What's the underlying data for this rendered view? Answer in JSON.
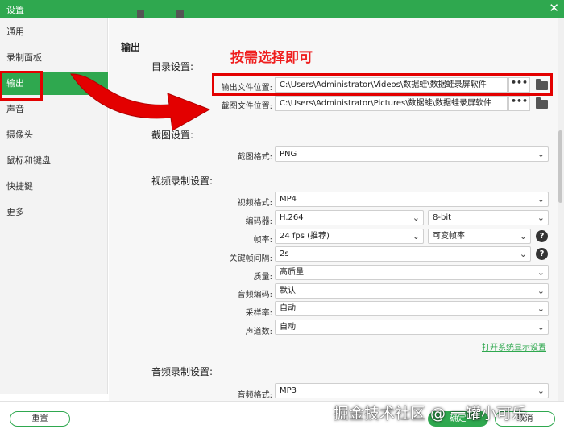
{
  "window": {
    "title": "设置",
    "close_glyph": "✕"
  },
  "sidebar": {
    "items": [
      {
        "label": "通用"
      },
      {
        "label": "录制面板"
      },
      {
        "label": "输出"
      },
      {
        "label": "声音"
      },
      {
        "label": "摄像头"
      },
      {
        "label": "鼠标和键盘"
      },
      {
        "label": "快捷键"
      },
      {
        "label": "更多"
      }
    ],
    "active_index": 2
  },
  "output": {
    "heading": "输出",
    "directory": {
      "heading": "目录设置:",
      "output_label": "输出文件位置:",
      "output_path": "C:\\Users\\Administrator\\Videos\\数据蛙\\数据蛙录屏软件",
      "screenshot_label": "截图文件位置:",
      "screenshot_path": "C:\\Users\\Administrator\\Pictures\\数据蛙\\数据蛙录屏软件",
      "browse_glyph": "•••"
    },
    "screenshot": {
      "heading": "截图设置:",
      "format_label": "截图格式:",
      "format_value": "PNG"
    },
    "video": {
      "heading": "视频录制设置:",
      "format_label": "视频格式:",
      "format_value": "MP4",
      "encoder_label": "编码器:",
      "encoder_value": "H.264",
      "bitdepth_value": "8-bit",
      "framerate_label": "帧率:",
      "framerate_value": "24 fps (推荐)",
      "framerate_mode_value": "可变帧率",
      "keyframe_label": "关键帧间隔:",
      "keyframe_value": "2s",
      "quality_label": "质量:",
      "quality_value": "高质量",
      "audio_codec_label": "音频编码:",
      "audio_codec_value": "默认",
      "samplerate_label": "采样率:",
      "samplerate_value": "自动",
      "channels_label": "声道数:",
      "channels_value": "自动",
      "display_settings_link": "打开系统显示设置"
    },
    "audio": {
      "heading": "音频录制设置:",
      "format_label": "音频格式:",
      "format_value": "MP3"
    }
  },
  "footer": {
    "reset_label": "重置",
    "ok_label": "确定",
    "cancel_label": "取消"
  },
  "annotation": {
    "text": "按需选择即可",
    "color": "#e30000"
  },
  "watermark": {
    "text": "掘金技术社区 @ 一罐小可乐"
  },
  "colors": {
    "accent": "#2fa84f"
  },
  "icons": {
    "chevron": "⌄",
    "help": "?"
  }
}
